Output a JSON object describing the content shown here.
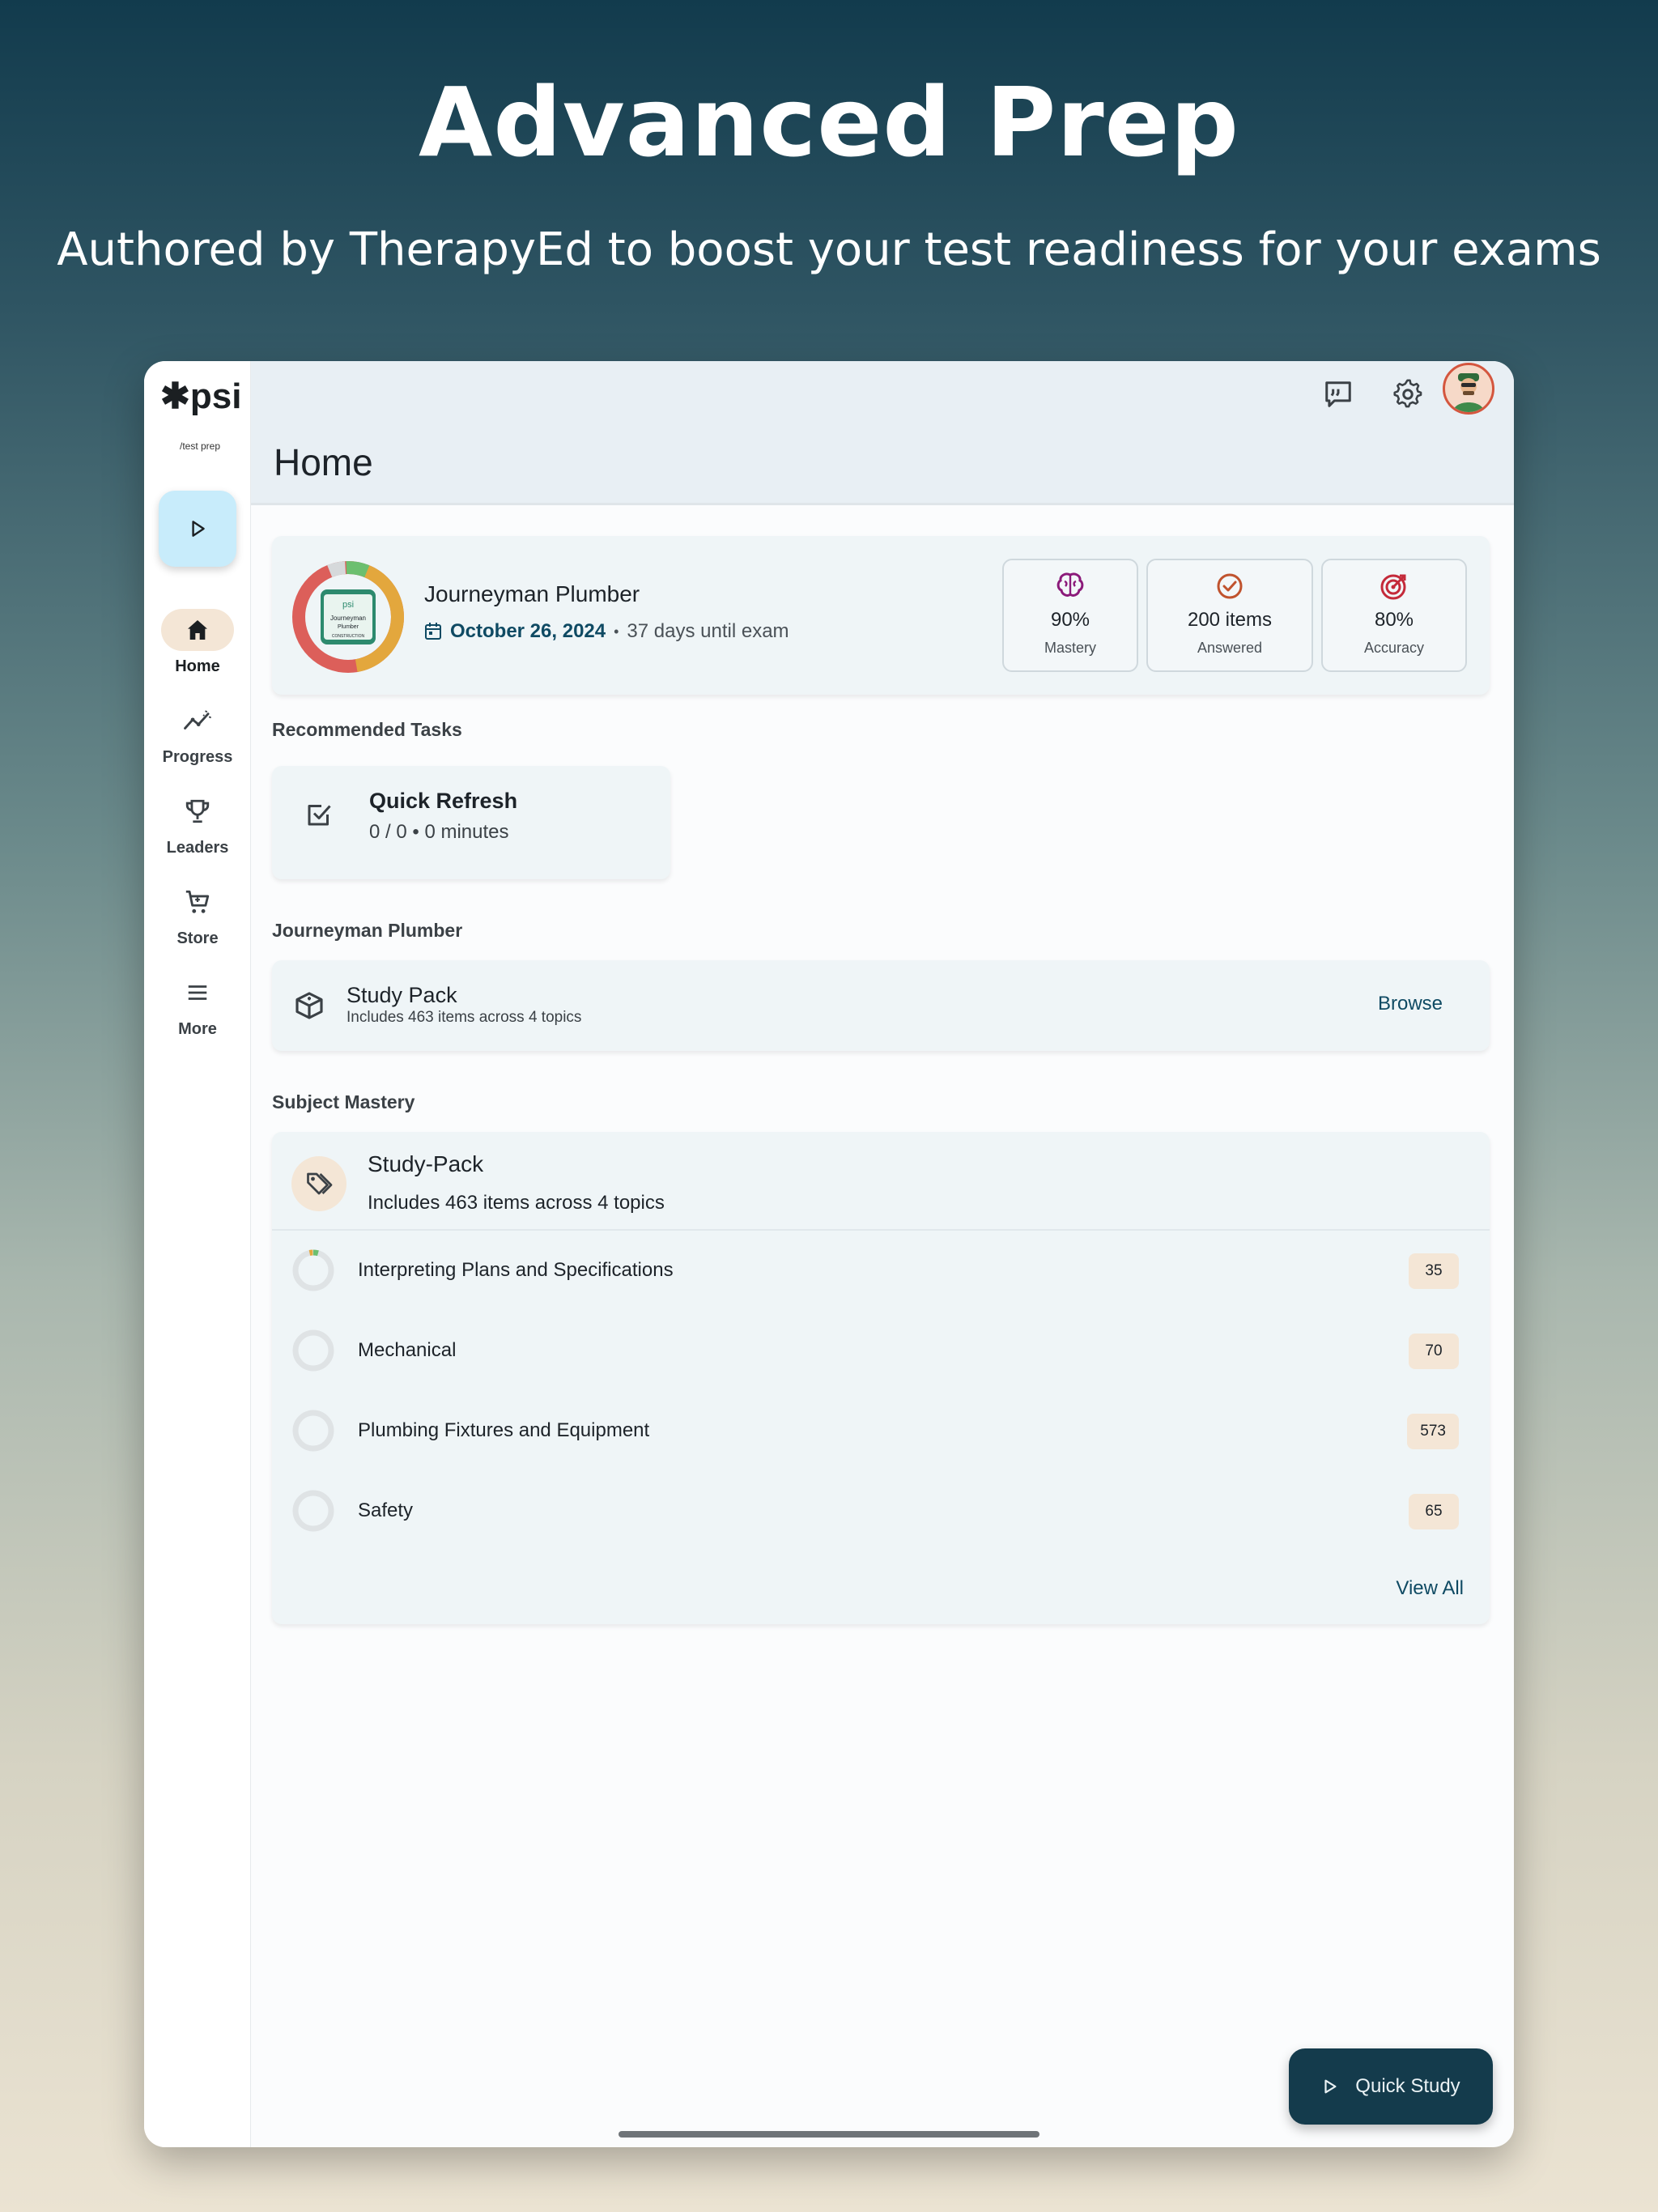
{
  "promo": {
    "title": "Advanced Prep",
    "subtitle": "Authored by TherapyEd to boost your test readiness for your exams"
  },
  "brand": {
    "logo": "✱psi",
    "logo_sub": "/test prep"
  },
  "sidebar": {
    "items": [
      {
        "label": "Home",
        "icon": "home-icon"
      },
      {
        "label": "Progress",
        "icon": "trend-icon"
      },
      {
        "label": "Leaders",
        "icon": "trophy-icon"
      },
      {
        "label": "Store",
        "icon": "cart-icon"
      },
      {
        "label": "More",
        "icon": "menu-icon"
      }
    ]
  },
  "header": {
    "title": "Home"
  },
  "exam": {
    "name": "Journeyman Plumber",
    "date": "October 26, 2024",
    "separator": "•",
    "days_until": "37 days until exam",
    "badge": {
      "brand": "psi",
      "line1": "Journeyman",
      "line2": "Plumber",
      "tag": "CONSTRUCTION"
    },
    "ring_colors": {
      "red": "#dc5f5a",
      "gold": "#e3a73d",
      "green": "#6cbf6f",
      "grey": "#d6d9db"
    }
  },
  "stats": [
    {
      "value": "90%",
      "label": "Mastery",
      "icon": "brain-icon",
      "color": "#8b1a7a"
    },
    {
      "value": "200 items",
      "label": "Answered",
      "icon": "check-circle-icon",
      "color": "#c0532e"
    },
    {
      "value": "80%",
      "label": "Accuracy",
      "icon": "target-icon",
      "color": "#c42a3a"
    }
  ],
  "sections": {
    "recommended": "Recommended Tasks",
    "exam_name": "Journeyman Plumber",
    "mastery": "Subject Mastery"
  },
  "task": {
    "title": "Quick Refresh",
    "meta": "0 / 0 • 0 minutes"
  },
  "study_pack": {
    "title": "Study Pack",
    "subtitle": "Includes 463 items across 4 topics",
    "action": "Browse"
  },
  "mastery": {
    "title": "Study-Pack",
    "subtitle": "Includes 463 items across 4 topics",
    "topics": [
      {
        "name": "Interpreting Plans and Specifications",
        "count": "35"
      },
      {
        "name": "Mechanical",
        "count": "70"
      },
      {
        "name": "Plumbing Fixtures and Equipment",
        "count": "573"
      },
      {
        "name": "Safety",
        "count": "65"
      }
    ],
    "view_all": "View All"
  },
  "fab": {
    "label": "Quick Study"
  }
}
